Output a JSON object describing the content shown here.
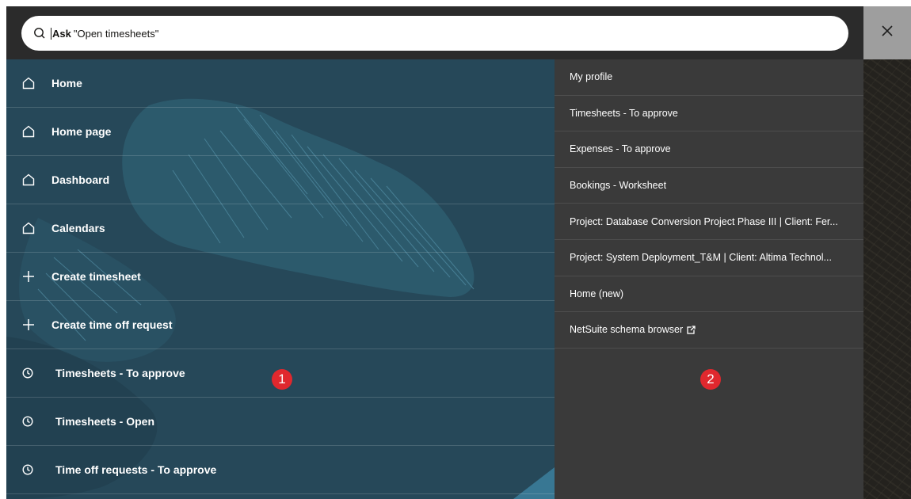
{
  "search": {
    "icon": "search-icon",
    "ask_label": "Ask",
    "prompt": "\"Open timesheets\""
  },
  "close_icon": "close-icon",
  "nav_items": [
    {
      "icon": "home-icon",
      "label": "Home"
    },
    {
      "icon": "home-icon",
      "label": "Home page"
    },
    {
      "icon": "home-icon",
      "label": "Dashboard"
    },
    {
      "icon": "home-icon",
      "label": "Calendars"
    },
    {
      "icon": "plus-icon",
      "label": "Create timesheet"
    },
    {
      "icon": "plus-icon",
      "label": "Create time off request"
    },
    {
      "icon": "clock-icon",
      "label": "Timesheets - To approve"
    },
    {
      "icon": "clock-icon",
      "label": "Timesheets - Open"
    },
    {
      "icon": "clock-icon",
      "label": "Time off requests - To approve"
    }
  ],
  "recent_items": [
    {
      "label": "My profile"
    },
    {
      "label": "Timesheets - To approve"
    },
    {
      "label": "Expenses - To approve"
    },
    {
      "label": "Bookings - Worksheet"
    },
    {
      "label": "Project: Database Conversion Project Phase III | Client: Fer..."
    },
    {
      "label": "Project: System Deployment_T&M | Client: Altima Technol..."
    },
    {
      "label": "Home (new)"
    },
    {
      "label": "NetSuite schema browser",
      "icon": "external-link-icon"
    }
  ],
  "callouts": {
    "one": "1",
    "two": "2"
  },
  "colors": {
    "left_panel": "#264859",
    "right_panel": "#3a3a3a",
    "callout": "#e0282e",
    "close_button": "#9e9e9e"
  }
}
